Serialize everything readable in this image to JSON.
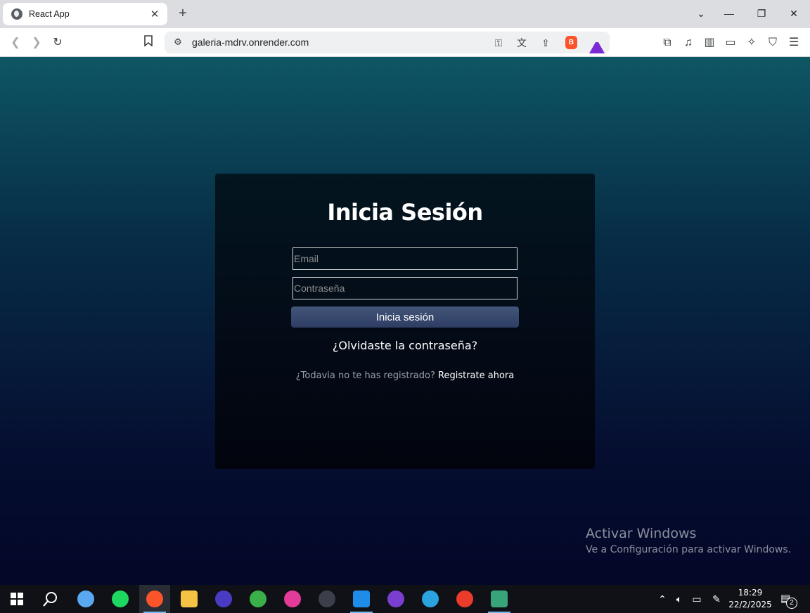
{
  "browser": {
    "tab_title": "React App",
    "tab_close": "✕",
    "new_tab": "+",
    "url": "galeria-mdrv.onrender.com",
    "controls": {
      "dropdown": "⌄",
      "minimize": "—",
      "restore": "❐",
      "close": "✕"
    }
  },
  "login": {
    "heading": "Inicia Sesión",
    "email_placeholder": "Email",
    "password_placeholder": "Contraseña",
    "submit_label": "Inicia sesión",
    "forgot_label": "¿Olvidaste la contraseña?",
    "signup_prompt": "¿Todavia no te has registrado?",
    "signup_link": "Registrate ahora"
  },
  "watermark": {
    "line1": "Activar Windows",
    "line2": "Ve a Configuración para activar Windows."
  },
  "taskbar": {
    "time": "18:29",
    "date": "22/2/2025",
    "notification_count": "2",
    "apps": [
      {
        "name": "copilot-icon",
        "color": "#5aa8f2"
      },
      {
        "name": "spotify-icon",
        "color": "#1ed760"
      },
      {
        "name": "brave-icon",
        "color": "#fb542b"
      },
      {
        "name": "file-explorer-icon",
        "color": "#f6c244"
      },
      {
        "name": "musescore-icon",
        "color": "#4b3bc4"
      },
      {
        "name": "resolve-app-icon",
        "color": "#3bb04a"
      },
      {
        "name": "app-icon-pink",
        "color": "#e23b9a"
      },
      {
        "name": "davinci-resolve-icon",
        "color": "#3a3f4a"
      },
      {
        "name": "vscode-icon",
        "color": "#1e8ce8"
      },
      {
        "name": "github-desktop-icon",
        "color": "#7b3fd0"
      },
      {
        "name": "telegram-icon",
        "color": "#2aa3e0"
      },
      {
        "name": "wps-office-icon",
        "color": "#ea3b2b"
      },
      {
        "name": "git-icon",
        "color": "#37a47a"
      }
    ]
  }
}
